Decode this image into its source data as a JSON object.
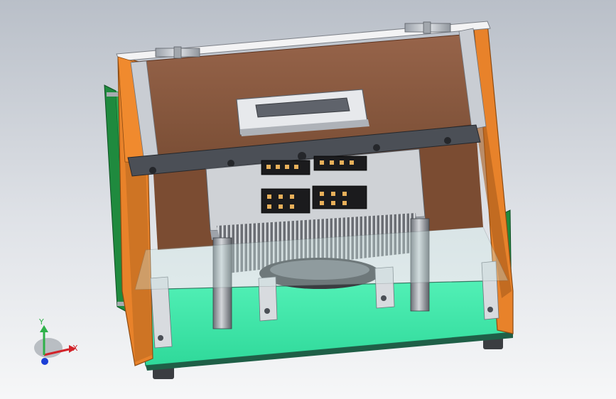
{
  "viewport": {
    "background_top": "#b9bfc8",
    "background_bottom": "#f6f7f8"
  },
  "model": {
    "panel_color": "#f08a2e",
    "inner_color": "#8a5a3c",
    "base_plate_color": "#37e6a8",
    "pcb_color": "#1f8a3e",
    "metal_color": "#c8ccd2"
  },
  "triad": {
    "x_label": "X",
    "y_label": "Y",
    "x_color": "#d2232a",
    "y_color": "#2fb14a",
    "z_color": "#1c3fd6"
  }
}
